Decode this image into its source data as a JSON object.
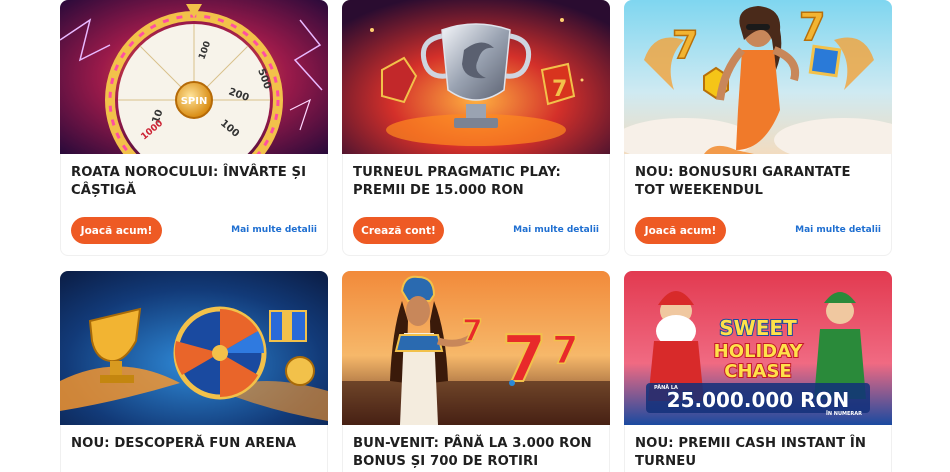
{
  "cards": [
    {
      "title": "ROATA NOROCULUI: ÎNVÂRTE ȘI CÂȘTIGĂ",
      "button": "Joacă acum!",
      "details": "Mai multe detalii",
      "image": "fortune-wheel-image",
      "image_text": [
        "SPIN",
        "500",
        "10",
        "200",
        "100",
        "1000",
        "100"
      ]
    },
    {
      "title": "TURNEUL PRAGMATIC PLAY: PREMII DE 15.000 RON",
      "button": "Crează cont!",
      "details": "Mai multe detalii",
      "image": "trophy-image"
    },
    {
      "title": "NOU: BONUSURI GARANTATE TOT WEEKENDUL",
      "button": "Joacă acum!",
      "details": "Mai multe detalii",
      "image": "woman-sevens-image",
      "image_text": [
        "7",
        "7"
      ]
    },
    {
      "title": "NOU: DESCOPERĂ FUN ARENA",
      "image": "fun-arena-image"
    },
    {
      "title": "BUN-VENIT: PÂNĂ LA 3.000 RON BONUS ȘI 700 DE ROTIRI GRATUITE",
      "image": "cleopatra-sevens-image",
      "image_text": [
        "7",
        "7",
        "7"
      ]
    },
    {
      "title": "NOU: PREMII CASH INSTANT ÎN TURNEU",
      "image": "sweet-holiday-chase-image",
      "image_text": [
        "SWEET",
        "HOLIDAY",
        "CHASE",
        "PÂNĂ LA",
        "25.000.000 RON",
        "ÎN NUMERAR"
      ]
    }
  ],
  "colors": {
    "button": "#ee5a24",
    "link": "#1f6fd1",
    "title": "#1f1f1f",
    "background": "#ffffff"
  }
}
